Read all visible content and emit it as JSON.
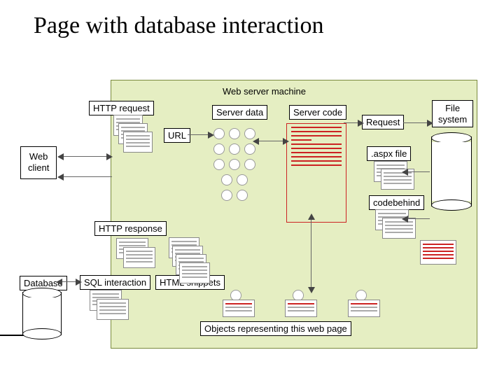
{
  "title": "Page with database interaction",
  "labels": {
    "web_server_machine": "Web server machine",
    "http_request": "HTTP request",
    "server_data": "Server data",
    "server_code": "Server code",
    "file_system": "File system",
    "request": "Request",
    "url": "URL",
    "web_client": "Web client",
    "aspx_file": ".aspx file",
    "codebehind": "codebehind",
    "http_response": "HTTP response",
    "database": "Database",
    "sql_interaction": "SQL interaction",
    "html_snippets": "HTML snippets",
    "objects_caption": "Objects representing this web page"
  }
}
